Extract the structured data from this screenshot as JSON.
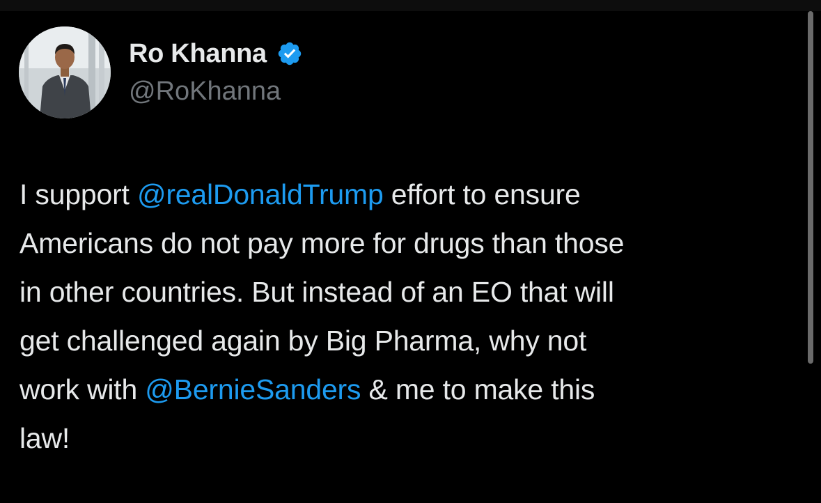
{
  "colors": {
    "background": "#000000",
    "text": "#e7e9ea",
    "secondary_text": "#71767b",
    "link": "#1d9bf0",
    "verified": "#1d9bf0"
  },
  "author": {
    "display_name": "Ro Khanna",
    "handle": "@RoKhanna",
    "verified_icon": "verified-badge-icon",
    "avatar_icon": "profile-photo"
  },
  "tweet": {
    "lines": [
      {
        "pre": "I support ",
        "mention": "@realDonaldTrump",
        "post": " effort to ensure"
      },
      {
        "text": "Americans do not pay more for drugs than those"
      },
      {
        "text": "in other countries. But instead of an EO that will"
      },
      {
        "text": "get challenged again by Big Pharma, why not"
      },
      {
        "pre": "work with ",
        "mention": "@BernieSanders",
        "post": " & me to make this"
      },
      {
        "text": "law!"
      }
    ]
  }
}
